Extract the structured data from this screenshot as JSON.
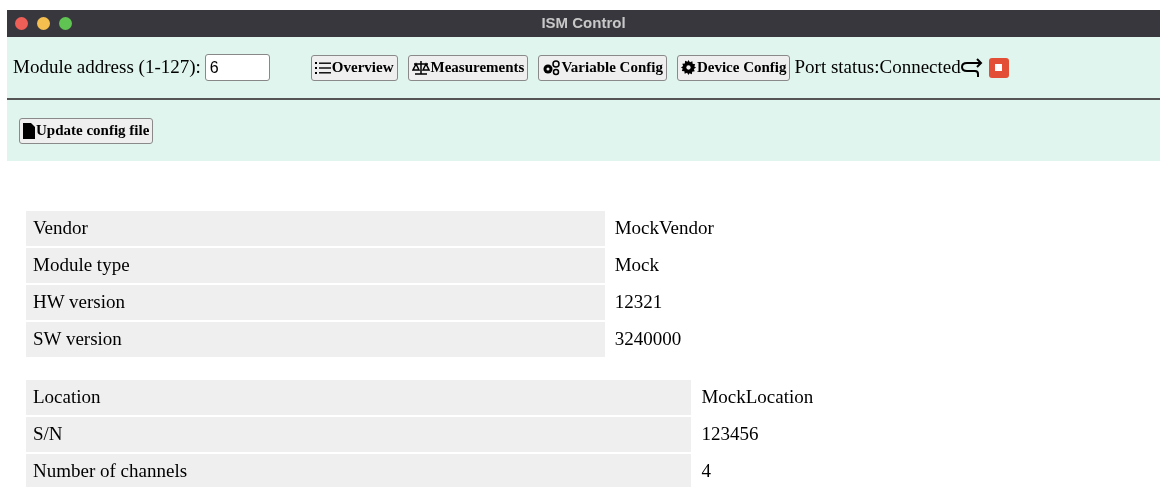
{
  "window": {
    "title": "ISM Control"
  },
  "toolbar": {
    "address_label": "Module address (1-127):",
    "address_value": "6",
    "nav_buttons": [
      {
        "kind": "list",
        "label": "Overview"
      },
      {
        "kind": "scale",
        "label": "Measurements"
      },
      {
        "kind": "gears",
        "label": "Variable Config"
      },
      {
        "kind": "gear",
        "label": "Device Config"
      }
    ],
    "port_status": "Port status:Connected"
  },
  "actions": [
    {
      "kind": "file",
      "label": "Update config file"
    }
  ],
  "tables": [
    {
      "rows": [
        {
          "label": "Vendor",
          "value": "MockVendor"
        },
        {
          "label": "Module type",
          "value": "Mock"
        },
        {
          "label": "HW version",
          "value": "12321"
        },
        {
          "label": "SW version",
          "value": "3240000"
        }
      ]
    },
    {
      "rows": [
        {
          "label": "Location",
          "value": "MockLocation"
        },
        {
          "label": "S/N",
          "value": "123456"
        },
        {
          "label": "Number of channels",
          "value": "4"
        }
      ]
    }
  ]
}
